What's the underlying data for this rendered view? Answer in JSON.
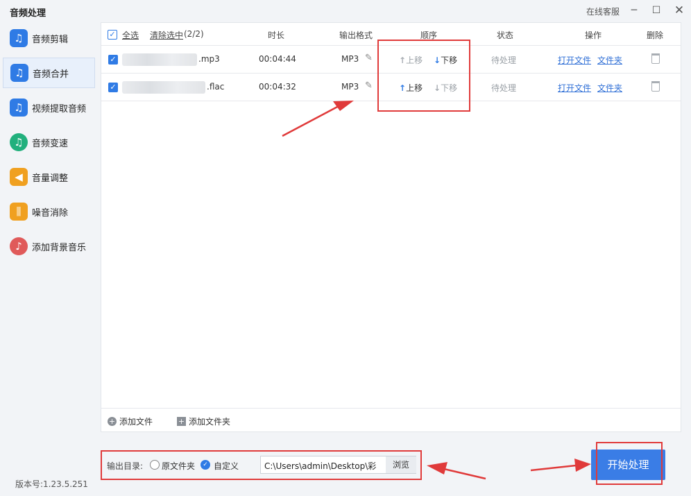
{
  "window": {
    "title": "音频处理",
    "service_label": "在线客服",
    "minimize": "─",
    "maximize": "☐",
    "close": "✕"
  },
  "sidebar": {
    "items": [
      {
        "label": "音频剪辑",
        "icon": "scissors-music-icon",
        "glyph": "♫",
        "color": "#2f7be5"
      },
      {
        "label": "音频合并",
        "icon": "merge-music-icon",
        "glyph": "♫",
        "color": "#2f7be5"
      },
      {
        "label": "视频提取音频",
        "icon": "extract-audio-icon",
        "glyph": "♫",
        "color": "#2f7be5"
      },
      {
        "label": "音频变速",
        "icon": "speed-icon",
        "glyph": "♫",
        "color": "#22b07d"
      },
      {
        "label": "音量调整",
        "icon": "volume-icon",
        "glyph": "◀",
        "color": "#f0a020"
      },
      {
        "label": "噪音消除",
        "icon": "noise-icon",
        "glyph": "⫼",
        "color": "#f0a020"
      },
      {
        "label": "添加背景音乐",
        "icon": "bg-music-icon",
        "glyph": "♪",
        "color": "#e05a5a"
      }
    ],
    "active_index": 1,
    "version": "版本号:1.23.5.251"
  },
  "table": {
    "select_all": "全选",
    "clear_selected": "清除选中",
    "selected_count": "(2/2)",
    "headers": {
      "duration": "时长",
      "format": "输出格式",
      "order": "顺序",
      "status": "状态",
      "actions": "操作",
      "delete": "删除"
    },
    "rows": [
      {
        "name_suffix": ".mp3",
        "duration": "00:04:44",
        "format": "MP3",
        "up": "上移",
        "down": "下移",
        "up_enabled": false,
        "down_enabled": true,
        "status": "待处理",
        "open_file": "打开文件",
        "open_folder": "文件夹"
      },
      {
        "name_suffix": ".flac",
        "duration": "00:04:32",
        "format": "MP3",
        "up": "上移",
        "down": "下移",
        "up_enabled": true,
        "down_enabled": false,
        "status": "待处理",
        "open_file": "打开文件",
        "open_folder": "文件夹"
      }
    ],
    "add_file": "添加文件",
    "add_folder": "添加文件夹"
  },
  "output": {
    "label": "输出目录:",
    "option_original": "原文件夹",
    "option_custom": "自定义",
    "selected": "custom",
    "path": "C:\\Users\\admin\\Desktop\\彩",
    "browse": "浏览"
  },
  "start_button": "开始处理",
  "colors": {
    "accent": "#2f7be5",
    "annotation": "#e03a3a",
    "link": "#2f6fd6"
  }
}
